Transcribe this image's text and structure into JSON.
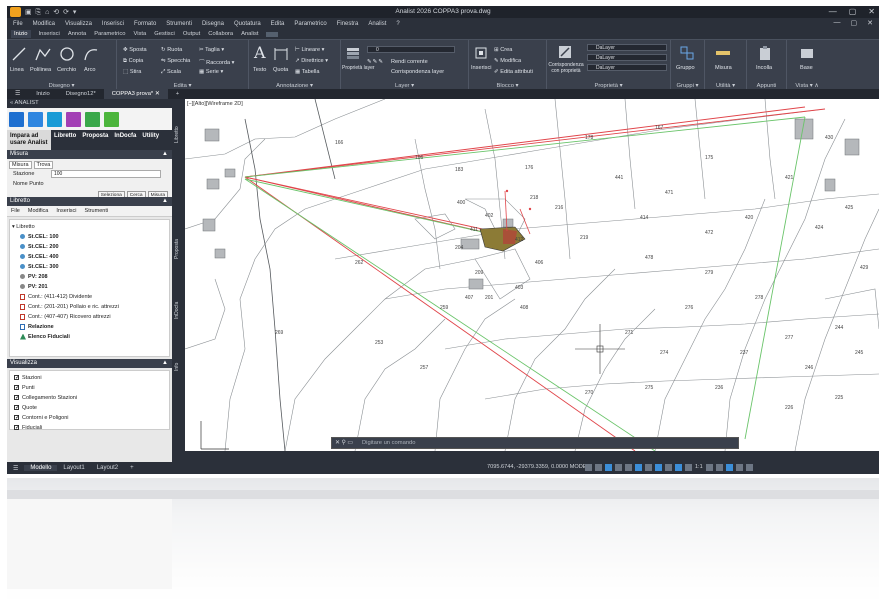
{
  "window": {
    "title": "Analist 2026    COPPA3 prova.dwg",
    "controls": [
      "—",
      "▢",
      "✕"
    ]
  },
  "menubar": {
    "items": [
      "File",
      "Modifica",
      "Visualizza",
      "Inserisci",
      "Formato",
      "Strumenti",
      "Disegna",
      "Quotatura",
      "Edita",
      "Parametrico",
      "Finestra",
      "Analist",
      "?"
    ]
  },
  "ribbon_tabs": {
    "items": [
      "Inizio",
      "Inserisci",
      "Annota",
      "Parametrico",
      "Vista",
      "Gestisci",
      "Output",
      "Collabora",
      "Analist"
    ],
    "active": "Inizio"
  },
  "ribbon": {
    "disegna": {
      "label": "Disegno ▾",
      "tools": [
        "Linea",
        "Polilinea",
        "Cerchio",
        "Arco"
      ]
    },
    "edita": {
      "label": "Edita ▾",
      "tools": [
        "Sposta",
        "Ruota",
        "Taglia",
        "Copia",
        "Specchia",
        "Raccorda",
        "Stira",
        "Scala",
        "Serie"
      ]
    },
    "annotazione": {
      "label": "Annotazione ▾",
      "tools": [
        "Testo",
        "Quota",
        "Lineare",
        "Direttrice",
        "Tabella"
      ]
    },
    "layer": {
      "label": "Layer ▾",
      "tools": [
        "Proprietà layer",
        "Rendi corrente",
        "Corrispondenza layer"
      ],
      "current": "0"
    },
    "blocco": {
      "label": "Blocco ▾",
      "tools": [
        "Inserisci",
        "Crea",
        "Modifica",
        "Edita attributi"
      ]
    },
    "proprieta": {
      "label": "Proprietà ▾",
      "tools": [
        "Corrispondenza con proprietà"
      ],
      "combos": [
        "DaLayer",
        "DaLayer",
        "DaLayer"
      ]
    },
    "gruppi": {
      "label": "Gruppi ▾",
      "tools": [
        "Gruppo"
      ]
    },
    "utilita": {
      "label": "Utilità ▾",
      "tools": [
        "Misura"
      ]
    },
    "appunti": {
      "label": "Appunti",
      "tools": [
        "Incolla"
      ]
    },
    "vista": {
      "label": "Vista ▾ ∧",
      "tools": [
        "Base"
      ]
    }
  },
  "doc_tabs": {
    "items": [
      "Inizio",
      "Disegno12*",
      "COPPA3 prova*"
    ],
    "active": "COPPA3 prova*",
    "close": "✕",
    "add": "+"
  },
  "panel": {
    "title": "ANALIST",
    "nav": [
      "Impara ad usare Analist",
      "Libretto",
      "Proposta",
      "InDocfa",
      "Utility"
    ],
    "misura": {
      "title": "Misura",
      "tabs": [
        "Misura",
        "Trova"
      ],
      "stazione_label": "Stazione",
      "stazione_value": "100",
      "nome_punto_label": "Nome Punto",
      "buttons": [
        "Seleziona",
        "Cerca",
        "Misura"
      ]
    },
    "libretto": {
      "title": "Libretto",
      "menu": [
        "File",
        "Modifica",
        "Inserisci",
        "Strumenti"
      ],
      "items": [
        "Libretto",
        "St.CEL: 100",
        "St.CEL: 200",
        "St.CEL: 400",
        "St.CEL: 300",
        "PV: 208",
        "PV: 201",
        "Cont.: (411-412) Dividente",
        "Cont.: (201-201) Pollaio e ric. attrezzi",
        "Cont.: (407-407) Ricovero attrezzi",
        "Relazione",
        "Elenco Fiduciali"
      ]
    },
    "visualizza": {
      "title": "Visualizza",
      "items": [
        "Stazioni",
        "Punti",
        "Collegamento Stazioni",
        "Quote",
        "Contorni e Poligoni",
        "Fiduciali"
      ]
    }
  },
  "side_strip": [
    "Libretto",
    "Proposta",
    "InDocfa",
    "Info"
  ],
  "drawing": {
    "view_label": "[−][Alto][Wireframe 2D]",
    "cmd_placeholder": "Digitare un comando",
    "parcel_numbers": [
      "183",
      "166",
      "196",
      "176",
      "178",
      "167",
      "175",
      "216",
      "219",
      "218",
      "204",
      "209",
      "201",
      "400",
      "402",
      "403",
      "408",
      "407",
      "406",
      "411",
      "412",
      "262",
      "253",
      "259",
      "257",
      "269",
      "270",
      "271",
      "274",
      "275",
      "276",
      "279",
      "278",
      "277",
      "244",
      "245",
      "246",
      "237",
      "236",
      "226",
      "225",
      "420",
      "421",
      "424",
      "425",
      "429",
      "430",
      "414",
      "441",
      "471",
      "472",
      "478"
    ],
    "colors": {
      "red": "#e0454a",
      "green": "#6ac46a",
      "parcel": "#8a8f93"
    }
  },
  "statusbar": {
    "tabs": [
      "Modello",
      "Layout1",
      "Layout2"
    ],
    "active": "Modello",
    "add": "+",
    "coords": "7095.6744, -29379.3359, 0.0000",
    "mode": "MODEL",
    "scale": "1:1"
  }
}
